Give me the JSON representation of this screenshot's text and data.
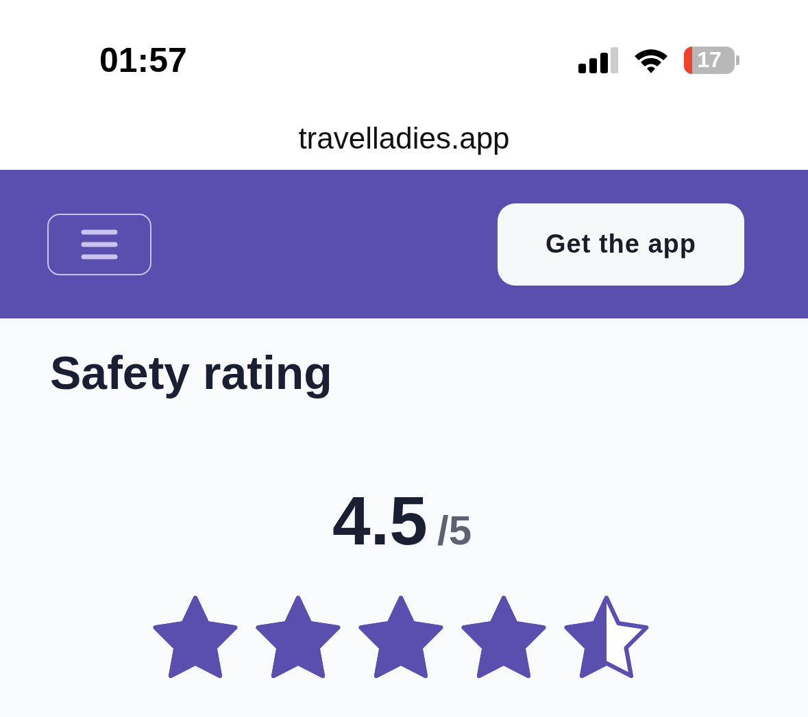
{
  "status_bar": {
    "time": "01:57",
    "battery": "17"
  },
  "address_bar": {
    "url": "travelladies.app"
  },
  "header": {
    "button": "Get the app"
  },
  "safety": {
    "title": "Safety rating",
    "score": "4.5",
    "out_of": "/5",
    "stars": 4.5
  }
}
